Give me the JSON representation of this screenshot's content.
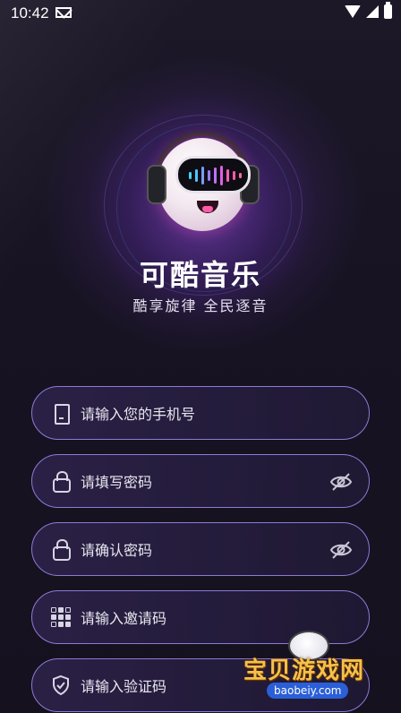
{
  "status_bar": {
    "time": "10:42"
  },
  "brand": {
    "app_name": "可酷音乐",
    "slogan": "酷享旋律 全民逐音"
  },
  "form": {
    "phone_placeholder": "请输入您的手机号",
    "password_placeholder": "请填写密码",
    "confirm_password_placeholder": "请确认密码",
    "invite_code_placeholder": "请输入邀请码",
    "verify_code_placeholder": "请输入验证码"
  },
  "watermark": {
    "name": "宝贝游戏网",
    "url": "baobeiy.com"
  },
  "colors": {
    "background": "#15121f",
    "field_border": "#8e7ad6",
    "text": "#e8e6f0",
    "watermark_gold": "#f5c14a",
    "watermark_blue": "#2b5fd8"
  },
  "icons": [
    "mail-icon",
    "wifi-icon",
    "signal-icon",
    "battery-icon",
    "phone-icon",
    "lock-icon",
    "eye-off-icon",
    "qr-code-icon",
    "shield-icon"
  ]
}
